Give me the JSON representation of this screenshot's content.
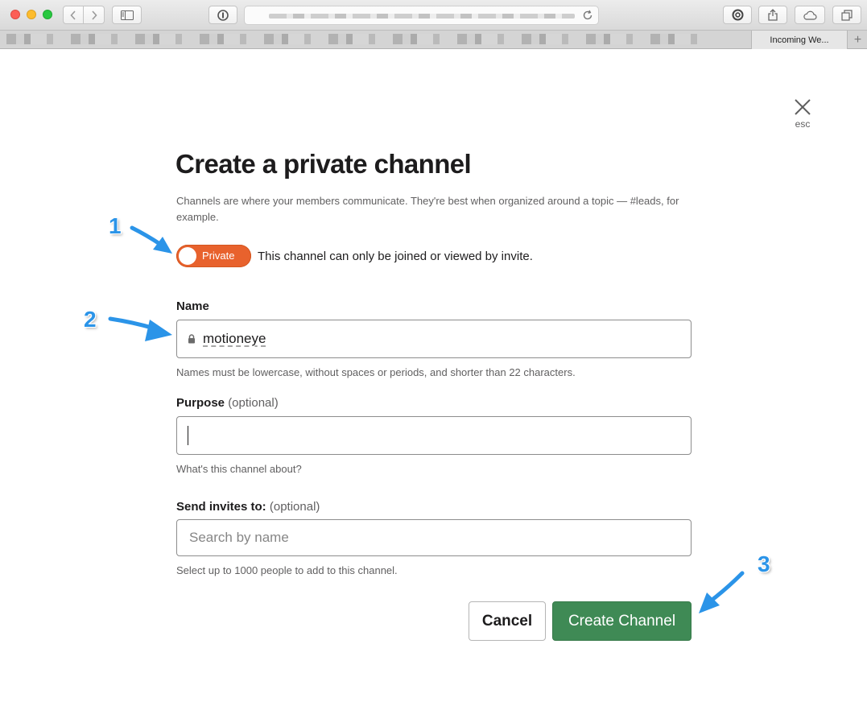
{
  "browser": {
    "tab_title": "Incoming We...",
    "new_tab_symbol": "+"
  },
  "modal": {
    "close_caption": "esc",
    "title": "Create a private channel",
    "intro": "Channels are where your members communicate. They're best when organized around a topic — #leads, for example.",
    "toggle": {
      "label": "Private",
      "state": "on",
      "color": "#e8622d",
      "description": "This channel can only be joined or viewed by invite."
    },
    "name_field": {
      "label": "Name",
      "value": "motioneye",
      "hint": "Names must be lowercase, without spaces or periods, and shorter than 22 characters."
    },
    "purpose_field": {
      "label": "Purpose",
      "optional": "(optional)",
      "value": "",
      "hint": "What's this channel about?"
    },
    "invites_field": {
      "label": "Send invites to:",
      "optional": "(optional)",
      "placeholder": "Search by name",
      "hint": "Select up to 1000 people to add to this channel."
    },
    "buttons": {
      "cancel": "Cancel",
      "create": "Create Channel",
      "create_color": "#3f8a55"
    }
  },
  "annotations": {
    "step1": "1",
    "step2": "2",
    "step3": "3",
    "color": "#2b94e8"
  }
}
